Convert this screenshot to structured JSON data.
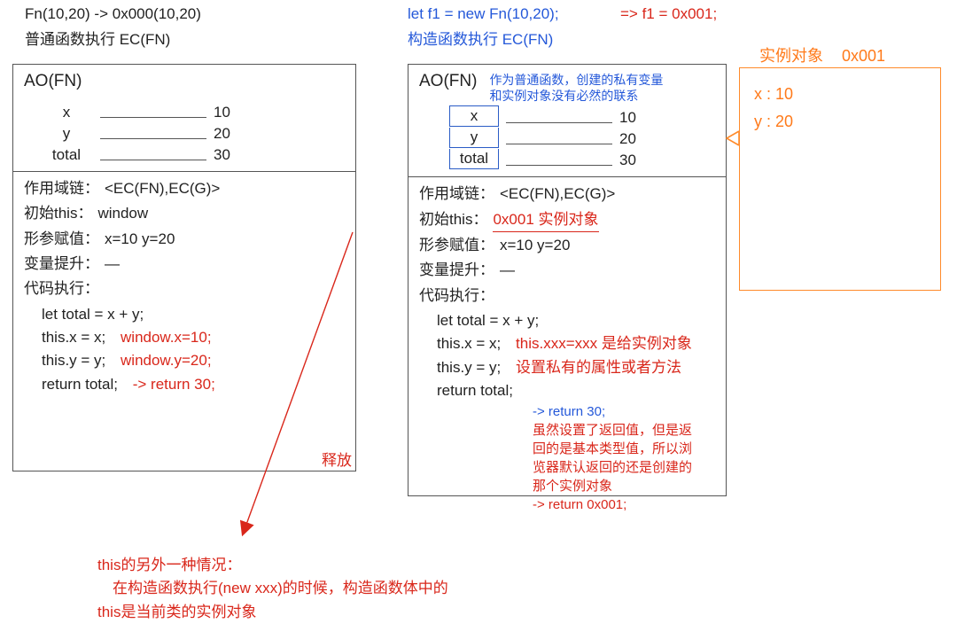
{
  "left": {
    "header_l1": "Fn(10,20)  -> 0x000(10,20)",
    "header_l2": "普通函数执行  EC(FN)",
    "ao_title": "AO(FN)",
    "vars": [
      {
        "name": "x",
        "val": "10"
      },
      {
        "name": "y",
        "val": "20"
      },
      {
        "name": "total",
        "val": "30"
      }
    ],
    "scope_label": "作用域链：",
    "scope_val": "<EC(FN),EC(G)>",
    "this_label": "初始this：",
    "this_val": "window",
    "args_label": "形参赋值：",
    "args_val": "x=10  y=20",
    "hoist_label": "变量提升：",
    "hoist_val": "—",
    "exec_label": "代码执行：",
    "code": [
      {
        "t": "let total = x + y;",
        "ann": ""
      },
      {
        "t": "this.x = x;",
        "ann": "window.x=10;"
      },
      {
        "t": "this.y = y;",
        "ann": "window.y=20;"
      },
      {
        "t": "return total;",
        "ann": "-> return 30;"
      }
    ],
    "release": "释放"
  },
  "right": {
    "header_blue1": "let f1 = new Fn(10,20);",
    "header_red": "=> f1 = 0x001;",
    "header_blue2": "构造函数执行  EC(FN)",
    "ao_title": "AO(FN)",
    "ao_note_l1": "作为普通函数，创建的私有变量",
    "ao_note_l2": "和实例对象没有必然的联系",
    "vars": [
      {
        "name": "x",
        "val": "10"
      },
      {
        "name": "y",
        "val": "20"
      },
      {
        "name": "total",
        "val": "30"
      }
    ],
    "scope_label": "作用域链：",
    "scope_val": "<EC(FN),EC(G)>",
    "this_label": "初始this：",
    "this_val": "0x001 实例对象",
    "args_label": "形参赋值：",
    "args_val": "x=10  y=20",
    "hoist_label": "变量提升：",
    "hoist_val": "—",
    "exec_label": "代码执行：",
    "code": [
      {
        "t": "let total = x + y;",
        "ann": ""
      },
      {
        "t": "this.x = x;",
        "ann": "this.xxx=xxx 是给实例对象"
      },
      {
        "t": "this.y = y;",
        "ann": "设置私有的属性或者方法"
      },
      {
        "t": "return total;",
        "ann": ""
      }
    ],
    "ret_note_blue": "-> return 30;",
    "ret_note_red_l1": "虽然设置了返回值，但是返",
    "ret_note_red_l2": "回的是基本类型值，所以浏",
    "ret_note_red_l3": "览器默认返回的还是创建的",
    "ret_note_red_l4": "那个实例对象",
    "ret_note_red_l5": "-> return 0x001;"
  },
  "instance": {
    "title_a": "实例对象",
    "title_b": "0x001",
    "l1": "x : 10",
    "l2": "y : 20"
  },
  "foot": {
    "l1": "this的另外一种情况：",
    "l2": " 在构造函数执行(new xxx)的时候，构造函数体中的",
    "l3": "this是当前类的实例对象"
  }
}
